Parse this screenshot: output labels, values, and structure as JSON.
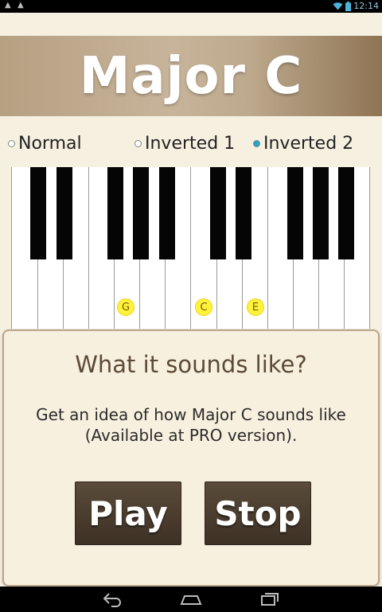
{
  "status_bar": {
    "left_icons": [
      "warning-icon",
      "warning-icon"
    ],
    "right_icons": [
      "wifi-icon",
      "battery-icon"
    ],
    "time": "12:14"
  },
  "header": {
    "title": "Major C"
  },
  "voicing": {
    "options": [
      {
        "label": "Normal",
        "selected": false
      },
      {
        "label": "Inverted 1",
        "selected": false
      },
      {
        "label": "Inverted 2",
        "selected": true
      }
    ]
  },
  "keyboard": {
    "white_key_count": 14,
    "markers": [
      {
        "note": "G",
        "white_key_index": 4
      },
      {
        "note": "C",
        "white_key_index": 7
      },
      {
        "note": "E",
        "white_key_index": 9
      }
    ]
  },
  "sound_card": {
    "heading": "What it sounds like?",
    "description_line1": "Get an idea of how Major C sounds like",
    "description_line2": "(Available at PRO version).",
    "play_label": "Play",
    "stop_label": "Stop"
  },
  "nav_bar": {
    "icons": [
      "back-icon",
      "home-icon",
      "recents-icon"
    ]
  },
  "colors": {
    "background": "#f6f0e1",
    "accent": "#2aa3c4",
    "button": "#4a3c2d",
    "marker": "#fff23b"
  }
}
